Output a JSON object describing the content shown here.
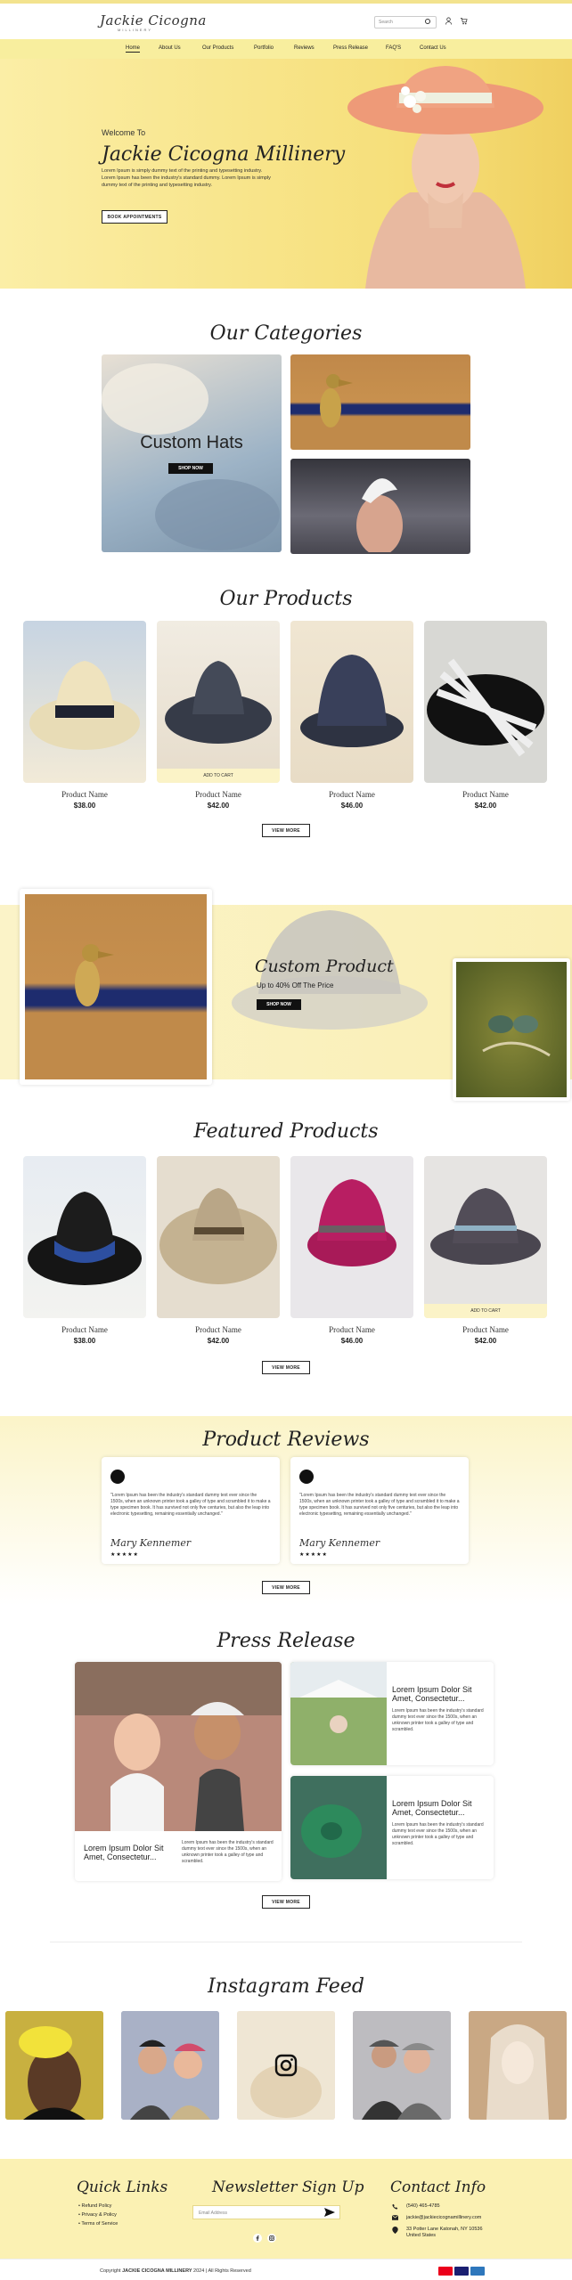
{
  "brand": {
    "name": "Jackie Cicogna",
    "tagline": "MILLINERY"
  },
  "header": {
    "search_placeholder": "Search"
  },
  "nav": {
    "items": [
      "Home",
      "About Us",
      "Our Products",
      "Portfolio",
      "Reviews",
      "Press Release",
      "FAQ'S",
      "Contact Us"
    ],
    "active": "Home"
  },
  "hero": {
    "welcome": "Welcome To",
    "title": "Jackie Cicogna Millinery",
    "body": "Lorem Ipsum is simply dummy text of the printing and typesetting industry. Lorem Ipsum has been the industry's standard dummy. Lorem Ipsum is simply dummy text of the printing and typesetting industry.",
    "button": "BOOK APPOINTMENTS"
  },
  "categories": {
    "title": "Our Categories",
    "featured_label": "Custom Hats",
    "featured_button": "SHOP NOW"
  },
  "products": {
    "title": "Our Products",
    "items": [
      {
        "name": "Product Name",
        "price": "$38.00"
      },
      {
        "name": "Product Name",
        "price": "$42.00",
        "cart": "ADD TO CART"
      },
      {
        "name": "Product Name",
        "price": "$46.00"
      },
      {
        "name": "Product Name",
        "price": "$42.00"
      }
    ],
    "view_more": "VIEW MORE"
  },
  "promo": {
    "title": "Custom Product",
    "subtitle": "Up to 40% Off The Price",
    "button": "SHOP NOW"
  },
  "featured": {
    "title": "Featured Products",
    "items": [
      {
        "name": "Product Name",
        "price": "$38.00"
      },
      {
        "name": "Product Name",
        "price": "$42.00"
      },
      {
        "name": "Product Name",
        "price": "$46.00"
      },
      {
        "name": "Product Name",
        "price": "$42.00",
        "cart": "ADD TO CART"
      }
    ],
    "view_more": "VIEW MORE"
  },
  "reviews": {
    "title": "Product Reviews",
    "items": [
      {
        "text": "\"Lorem Ipsum has been the industry's standard dummy text ever since the 1500s, when an unknown printer took a galley of type and scrambled it to make a type specimen book. It has survived not only five centuries, but also the leap into electronic typesetting, remaining essentially unchanged.\"",
        "author": "Mary Kennemer",
        "stars": "★★★★★"
      },
      {
        "text": "\"Lorem Ipsum has been the industry's standard dummy text ever since the 1500s, when an unknown printer took a galley of type and scrambled it to make a type specimen book. It has survived not only five centuries, but also the leap into electronic typesetting, remaining essentially unchanged.\"",
        "author": "Mary Kennemer",
        "stars": "★★★★★"
      }
    ],
    "view_more": "VIEW MORE"
  },
  "press": {
    "title": "Press Release",
    "items": [
      {
        "title": "Lorem Ipsum Dolor Sit Amet, Consectetur...",
        "text": "Lorem Ipsum has been the industry's standard dummy text ever since the 1500s, when an unknown printer took a galley of type and scrambled."
      },
      {
        "title": "Lorem Ipsum Dolor Sit Amet, Consectetur...",
        "text": "Lorem Ipsum has been the industry's standard dummy text ever since the 1500s, when an unknown printer took a galley of type and scrambled."
      },
      {
        "title": "Lorem Ipsum Dolor Sit Amet, Consectetur...",
        "text": "Lorem Ipsum has been the industry's standard dummy text ever since the 1500s, when an unknown printer took a galley of type and scrambled."
      }
    ],
    "view_more": "VIEW MORE"
  },
  "instagram": {
    "title": "Instagram Feed"
  },
  "footer": {
    "quick_links_title": "Quick Links",
    "quick_links": [
      "Refund Policy",
      "Privacy & Policy",
      "Terms of Service"
    ],
    "newsletter_title": "Newsletter Sign Up",
    "newsletter_placeholder": "Email Address",
    "contact_title": "Contact Info",
    "phone": "(540) 465-4785",
    "email": "jackie@jackiecicognamillinery.com",
    "address": "33 Potter Lane Katonah, NY 10536 United States",
    "copyright_prefix": "Copyright",
    "copyright_brand": "JACKIE CICOGNA MILLINERY",
    "copyright_suffix": "2024 | All Rights Reserved"
  }
}
